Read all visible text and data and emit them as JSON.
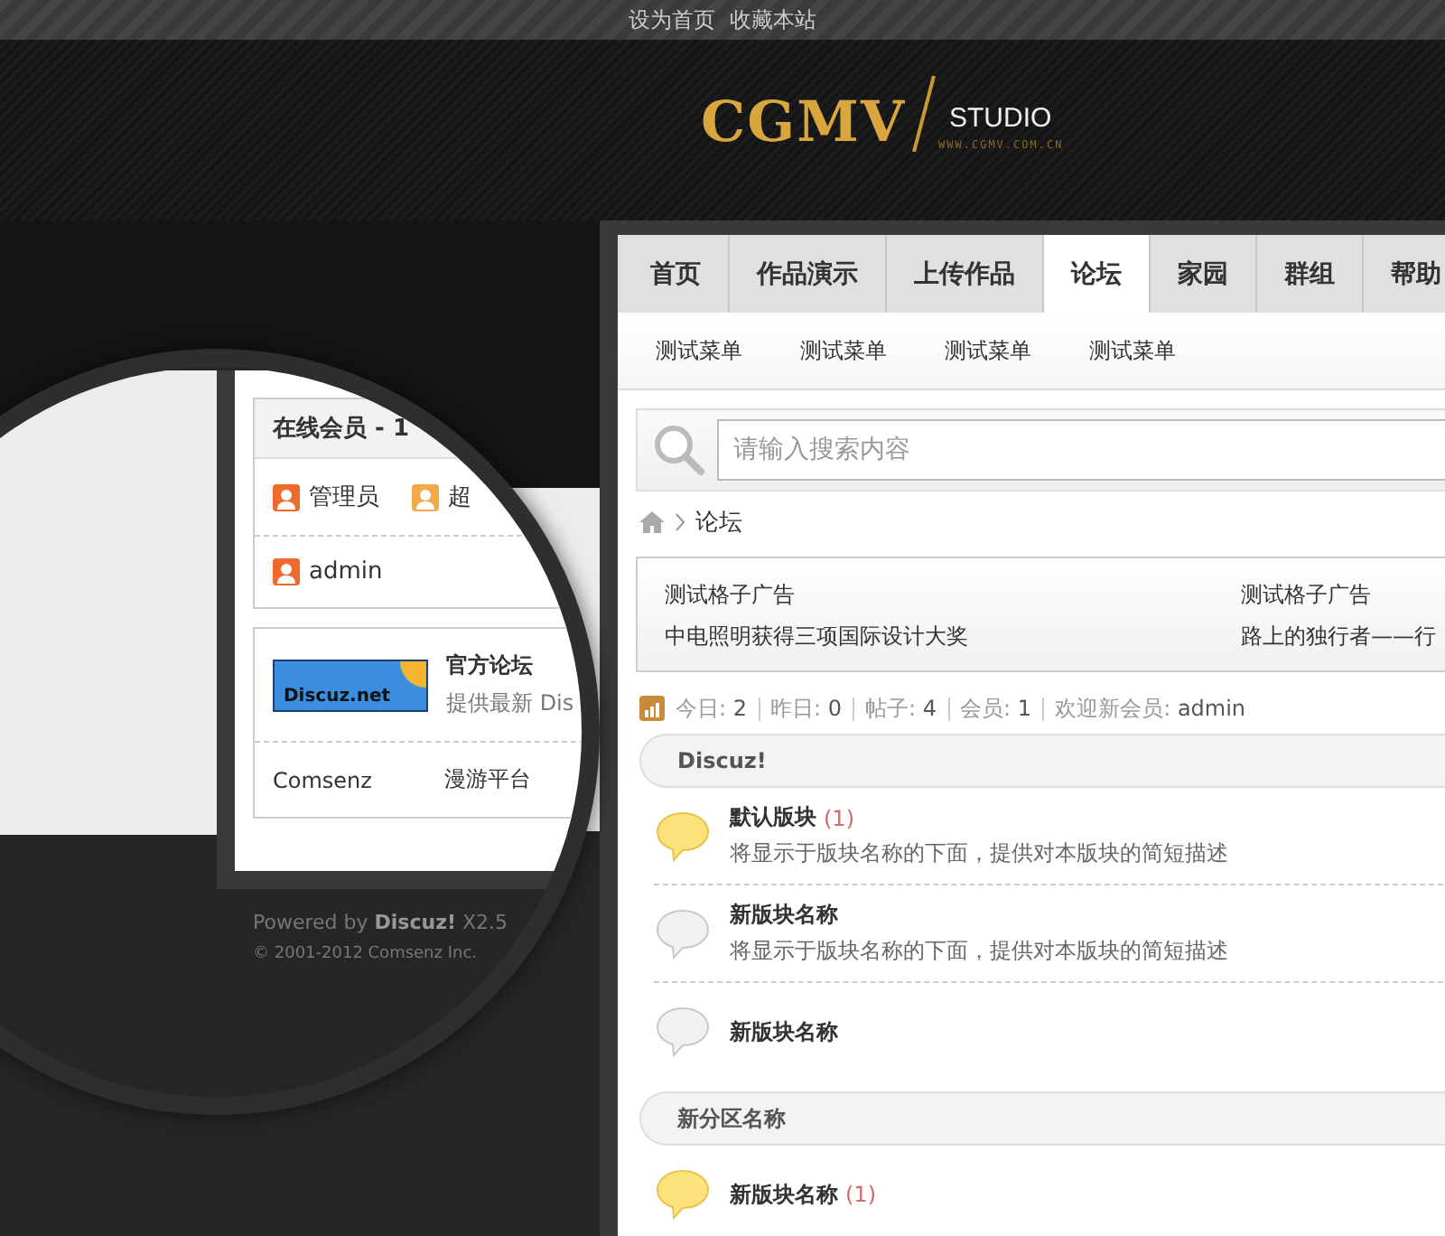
{
  "top_links": [
    "设为首页",
    "收藏本站"
  ],
  "logo": {
    "mark": "CGMV",
    "word": "STUDIO",
    "url": "WWW.CGMV.COM.CN"
  },
  "lens": {
    "online": {
      "title": "在线会员 - 1",
      "groups": [
        {
          "label": "管理员",
          "color": "#f06a2c"
        },
        {
          "label": "超",
          "color": "#f2a94a"
        }
      ],
      "members": [
        {
          "label": "admin",
          "color": "#f06a2c"
        }
      ]
    },
    "links": {
      "badge": "Discuz.net",
      "title": "官方论坛",
      "desc": "提供最新 Dis",
      "others": [
        "Comsenz",
        "漫游平台"
      ]
    },
    "footer": {
      "powered": "Powered by **Discuz!** X2.5",
      "copyright": "© 2001-2012 Comsenz Inc."
    }
  },
  "nav": [
    {
      "label": "首页",
      "selected": false
    },
    {
      "label": "作品演示",
      "selected": false
    },
    {
      "label": "上传作品",
      "selected": false
    },
    {
      "label": "论坛",
      "selected": true
    },
    {
      "label": "家园",
      "selected": false
    },
    {
      "label": "群组",
      "selected": false
    },
    {
      "label": "帮助",
      "selected": false
    }
  ],
  "subnav": [
    "测试菜单",
    "测试菜单",
    "测试菜单",
    "测试菜单"
  ],
  "search": {
    "placeholder": "请输入搜索内容"
  },
  "breadcrumb": [
    "论坛"
  ],
  "ads": [
    [
      "测试格子广告",
      "测试格子广告"
    ],
    [
      "中电照明获得三项国际设计大奖",
      "路上的独行者——行"
    ]
  ],
  "stats": [
    {
      "label": "今日:",
      "value": "2"
    },
    {
      "label": "昨日:",
      "value": "0"
    },
    {
      "label": "帖子:",
      "value": "4"
    },
    {
      "label": "会员:",
      "value": "1"
    },
    {
      "label": "欢迎新会员:",
      "value": "admin"
    }
  ],
  "categories": [
    {
      "title": "Discuz!",
      "forums": [
        {
          "name": "默认版块",
          "count": "(1)",
          "description": "将显示于版块名称的下面，提供对本版块的简短描述",
          "new": true
        },
        {
          "name": "新版块名称",
          "description": "将显示于版块名称的下面，提供对本版块的简短描述",
          "new": false
        },
        {
          "name": "新版块名称",
          "new": false
        }
      ]
    },
    {
      "title": "新分区名称",
      "forums": [
        {
          "name": "新版块名称",
          "count": "(1)",
          "new": true
        }
      ]
    }
  ]
}
